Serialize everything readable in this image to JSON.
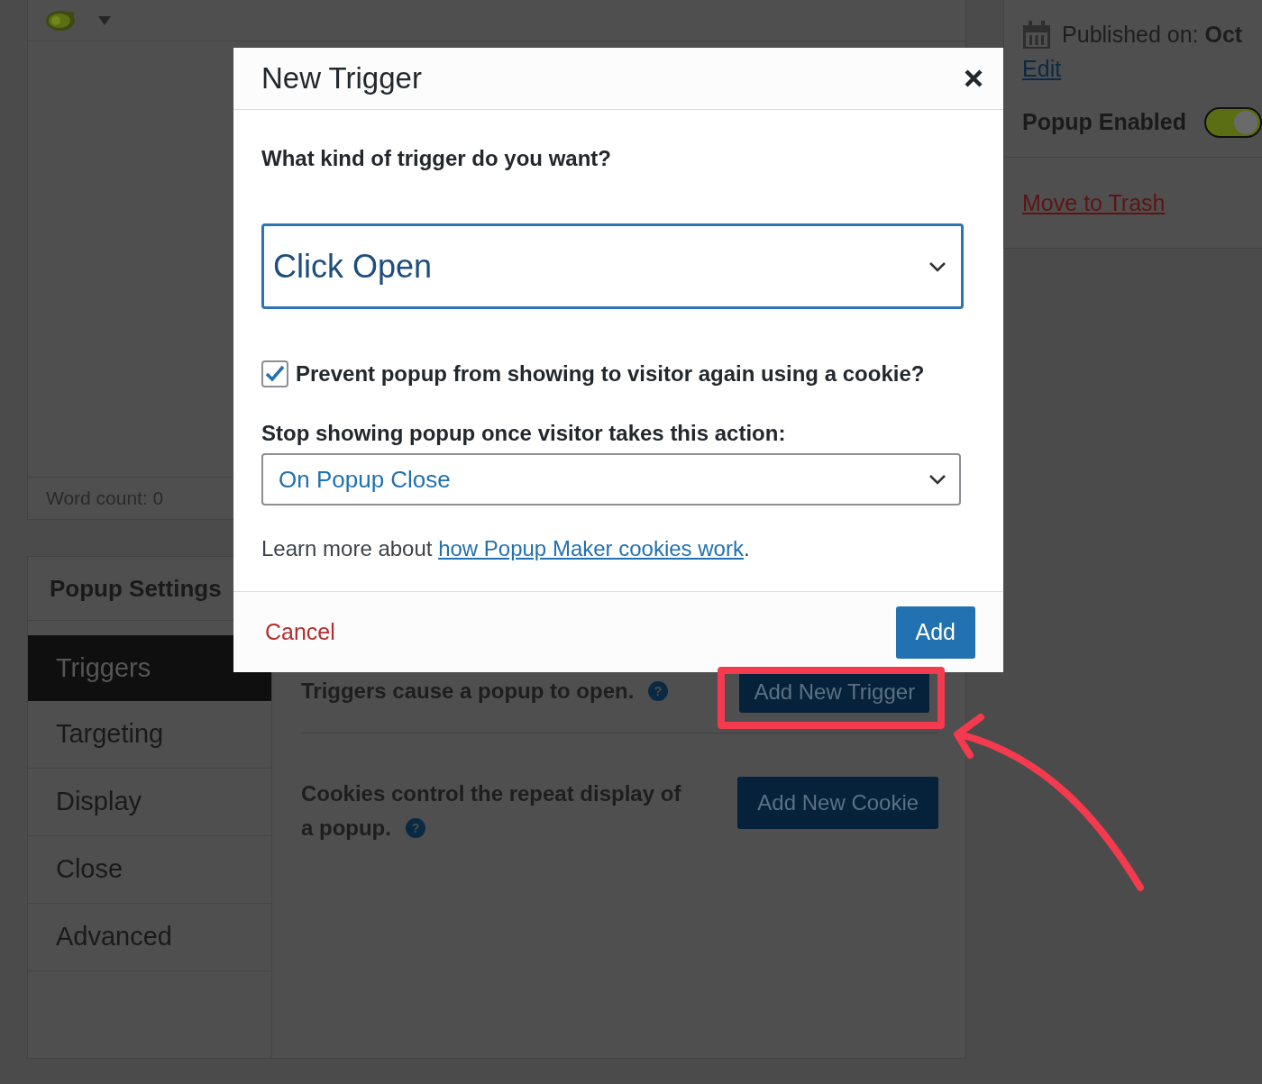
{
  "editor": {
    "word_count": "Word count: 0"
  },
  "publish_box": {
    "published": "Published on: **Oct**",
    "edit_link": "Edit",
    "enabled_label": "Popup Enabled",
    "enabled": true,
    "trash_link": "Move to Trash"
  },
  "settings": {
    "title": "Popup Settings",
    "tabs": [
      {
        "label": "Triggers",
        "selected": true
      },
      {
        "label": "Targeting",
        "selected": false
      },
      {
        "label": "Display",
        "selected": false
      },
      {
        "label": "Close",
        "selected": false
      },
      {
        "label": "Advanced",
        "selected": false
      }
    ],
    "triggers_text": "Triggers cause a popup to open.",
    "add_trigger": "Add New Trigger",
    "cookies_text_lines": [
      "Cookies control the repeat display of",
      "a popup."
    ],
    "help_mark": "?",
    "add_cookie": "Add New Cookie"
  },
  "dialog": {
    "title": "New Trigger",
    "question": "What kind of trigger do you want?",
    "trigger_select": {
      "value": "Click Open"
    },
    "cookie_checkbox": {
      "label": "Prevent popup from showing to visitor again using a cookie?",
      "checked": true
    },
    "stop_label": "Stop showing popup once visitor takes this action:",
    "stop_select": {
      "value": "On Popup Close"
    },
    "help_prefix": "Learn more about ",
    "help_link": "how Popup Maker cookies work",
    "help_suffix": ".",
    "cancel": "Cancel",
    "add": "Add"
  }
}
